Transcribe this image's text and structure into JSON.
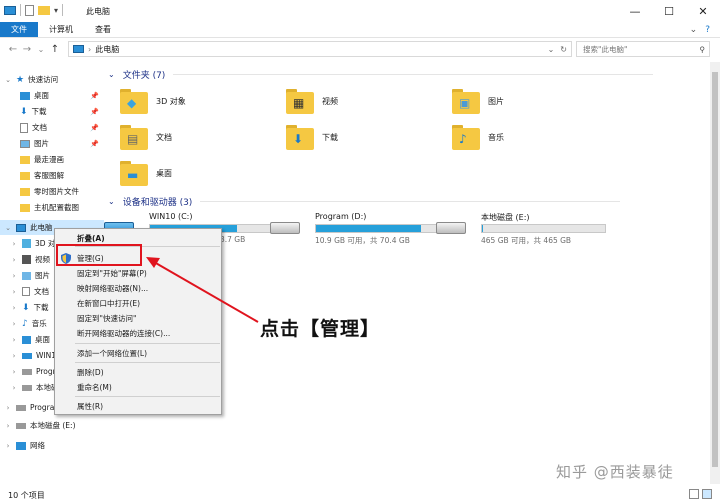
{
  "window": {
    "title": "此电脑",
    "minimize": "—",
    "maximize": "☐",
    "close": "✕"
  },
  "ribbon": {
    "tabs": [
      "文件",
      "计算机",
      "查看"
    ],
    "expand": "⌄",
    "help": "?"
  },
  "navbar": {
    "back": "←",
    "forward": "→",
    "recent": "⌄",
    "up": "↑",
    "path": "此电脑",
    "refresh": "↻",
    "search_placeholder": "搜索\"此电脑\""
  },
  "sidebar": {
    "quick_access": "快速访问",
    "quick_items": [
      "桌面",
      "下载",
      "文档",
      "图片",
      "最走漫画",
      "客服图解",
      "零时图片文件",
      "主机配置截图"
    ],
    "this_pc": "此电脑",
    "pc_items": [
      "3D 对象",
      "视频",
      "图片",
      "文档",
      "下载",
      "音乐",
      "桌面",
      "WIN10 (C:)",
      "Program (D:)",
      "本地磁盘 (E:)"
    ],
    "program_d": "Program (D:)",
    "local_e": "本地磁盘 (E:)",
    "network": "网络"
  },
  "folders": {
    "header": "文件夹 (7)",
    "items": [
      "3D 对象",
      "视频",
      "图片",
      "文档",
      "下载",
      "音乐",
      "桌面"
    ]
  },
  "drives": {
    "header": "设备和驱动器 (3)",
    "items": [
      {
        "name": "WIN10 (C:)",
        "size": "3.7 GB",
        "used_fraction": 0.71
      },
      {
        "name": "Program (D:)",
        "size": "10.9 GB 可用，共 70.4 GB",
        "used_fraction": 0.85
      },
      {
        "name": "本地磁盘 (E:)",
        "size": "465 GB 可用，共 465 GB",
        "used_fraction": 0.01
      }
    ]
  },
  "context_menu": {
    "collapse": "折叠(A)",
    "manage": "管理(G)",
    "pin_start": "固定到\"开始\"屏幕(P)",
    "map_drive": "映射网络驱动器(N)...",
    "open_new": "在新窗口中打开(E)",
    "pin_quick": "固定到\"快速访问\"",
    "disconnect": "断开网络驱动器的连接(C)...",
    "add_location": "添加一个网络位置(L)",
    "delete": "删除(D)",
    "rename": "重命名(M)",
    "properties": "属性(R)"
  },
  "annotation": {
    "callout": "点击【管理】",
    "color": "#e0141e"
  },
  "status": {
    "count": "10 个项目"
  },
  "watermark": "知乎 @西装暴徒",
  "colors": {
    "accent": "#1979ca",
    "selection": "#cce8ff",
    "folder": "#f5c842",
    "drive_bar": "#26a0da"
  }
}
